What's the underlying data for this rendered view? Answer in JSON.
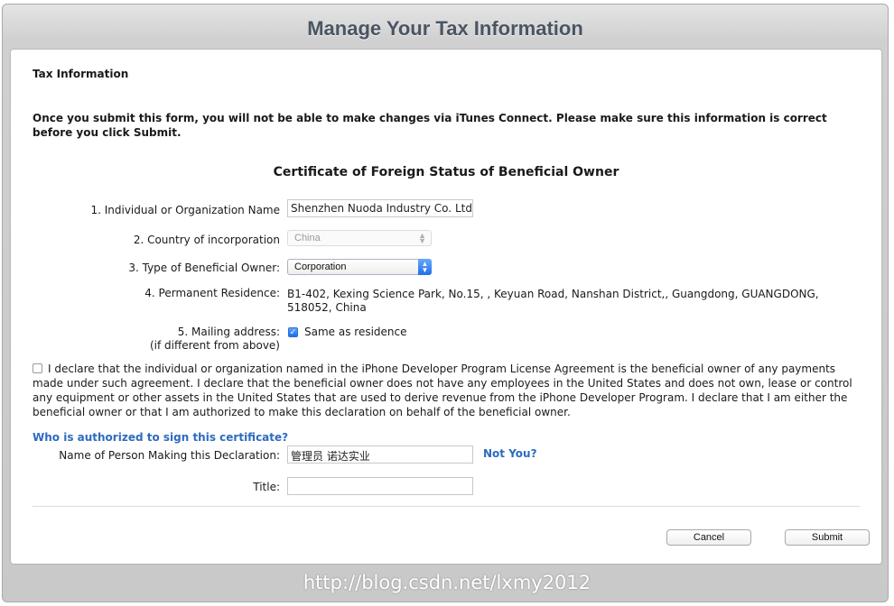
{
  "window": {
    "title": "Manage Your Tax Information"
  },
  "form": {
    "section_heading": "Tax Information",
    "warning": "Once you submit this form, you will not be able to make changes via iTunes Connect. Please make sure this information is correct before you click Submit.",
    "certificate_title": "Certificate of Foreign Status of Beneficial Owner",
    "fields": {
      "name_label": "1. Individual or Organization Name",
      "name_value": "Shenzhen Nuoda Industry Co. Ltd.",
      "country_label": "2. Country of incorporation",
      "country_value": "China",
      "owner_type_label": "3. Type of Beneficial Owner:",
      "owner_type_value": "Corporation",
      "residence_label": "4. Permanent Residence:",
      "residence_value": "B1-402, Kexing Science Park, No.15, , Keyuan Road, Nanshan District,, Guangdong, GUANGDONG, 518052, China",
      "mailing_label": "5. Mailing address:",
      "mailing_sublabel": "(if different from above)",
      "mailing_checkbox_label": "Same as residence"
    },
    "declaration": "I declare that the individual or organization named in the iPhone Developer Program License Agreement is the beneficial owner of any payments made under such agreement. I declare that the beneficial owner does not have any employees in the United States and does not own, lease or control any equipment or other assets in the United States that are used to derive revenue from the iPhone Developer Program. I declare that I am either the beneficial owner or that I am authorized to make this declaration on behalf of the beneficial owner.",
    "signer": {
      "heading": "Who is authorized to sign this certificate?",
      "name_label": "Name of Person Making this Declaration:",
      "name_value": "管理员 诺达实业",
      "not_you_link": "Not You?",
      "title_label": "Title:",
      "title_value": ""
    },
    "buttons": {
      "cancel": "Cancel",
      "submit": "Submit"
    }
  },
  "watermark": "http://blog.csdn.net/lxmy2012"
}
